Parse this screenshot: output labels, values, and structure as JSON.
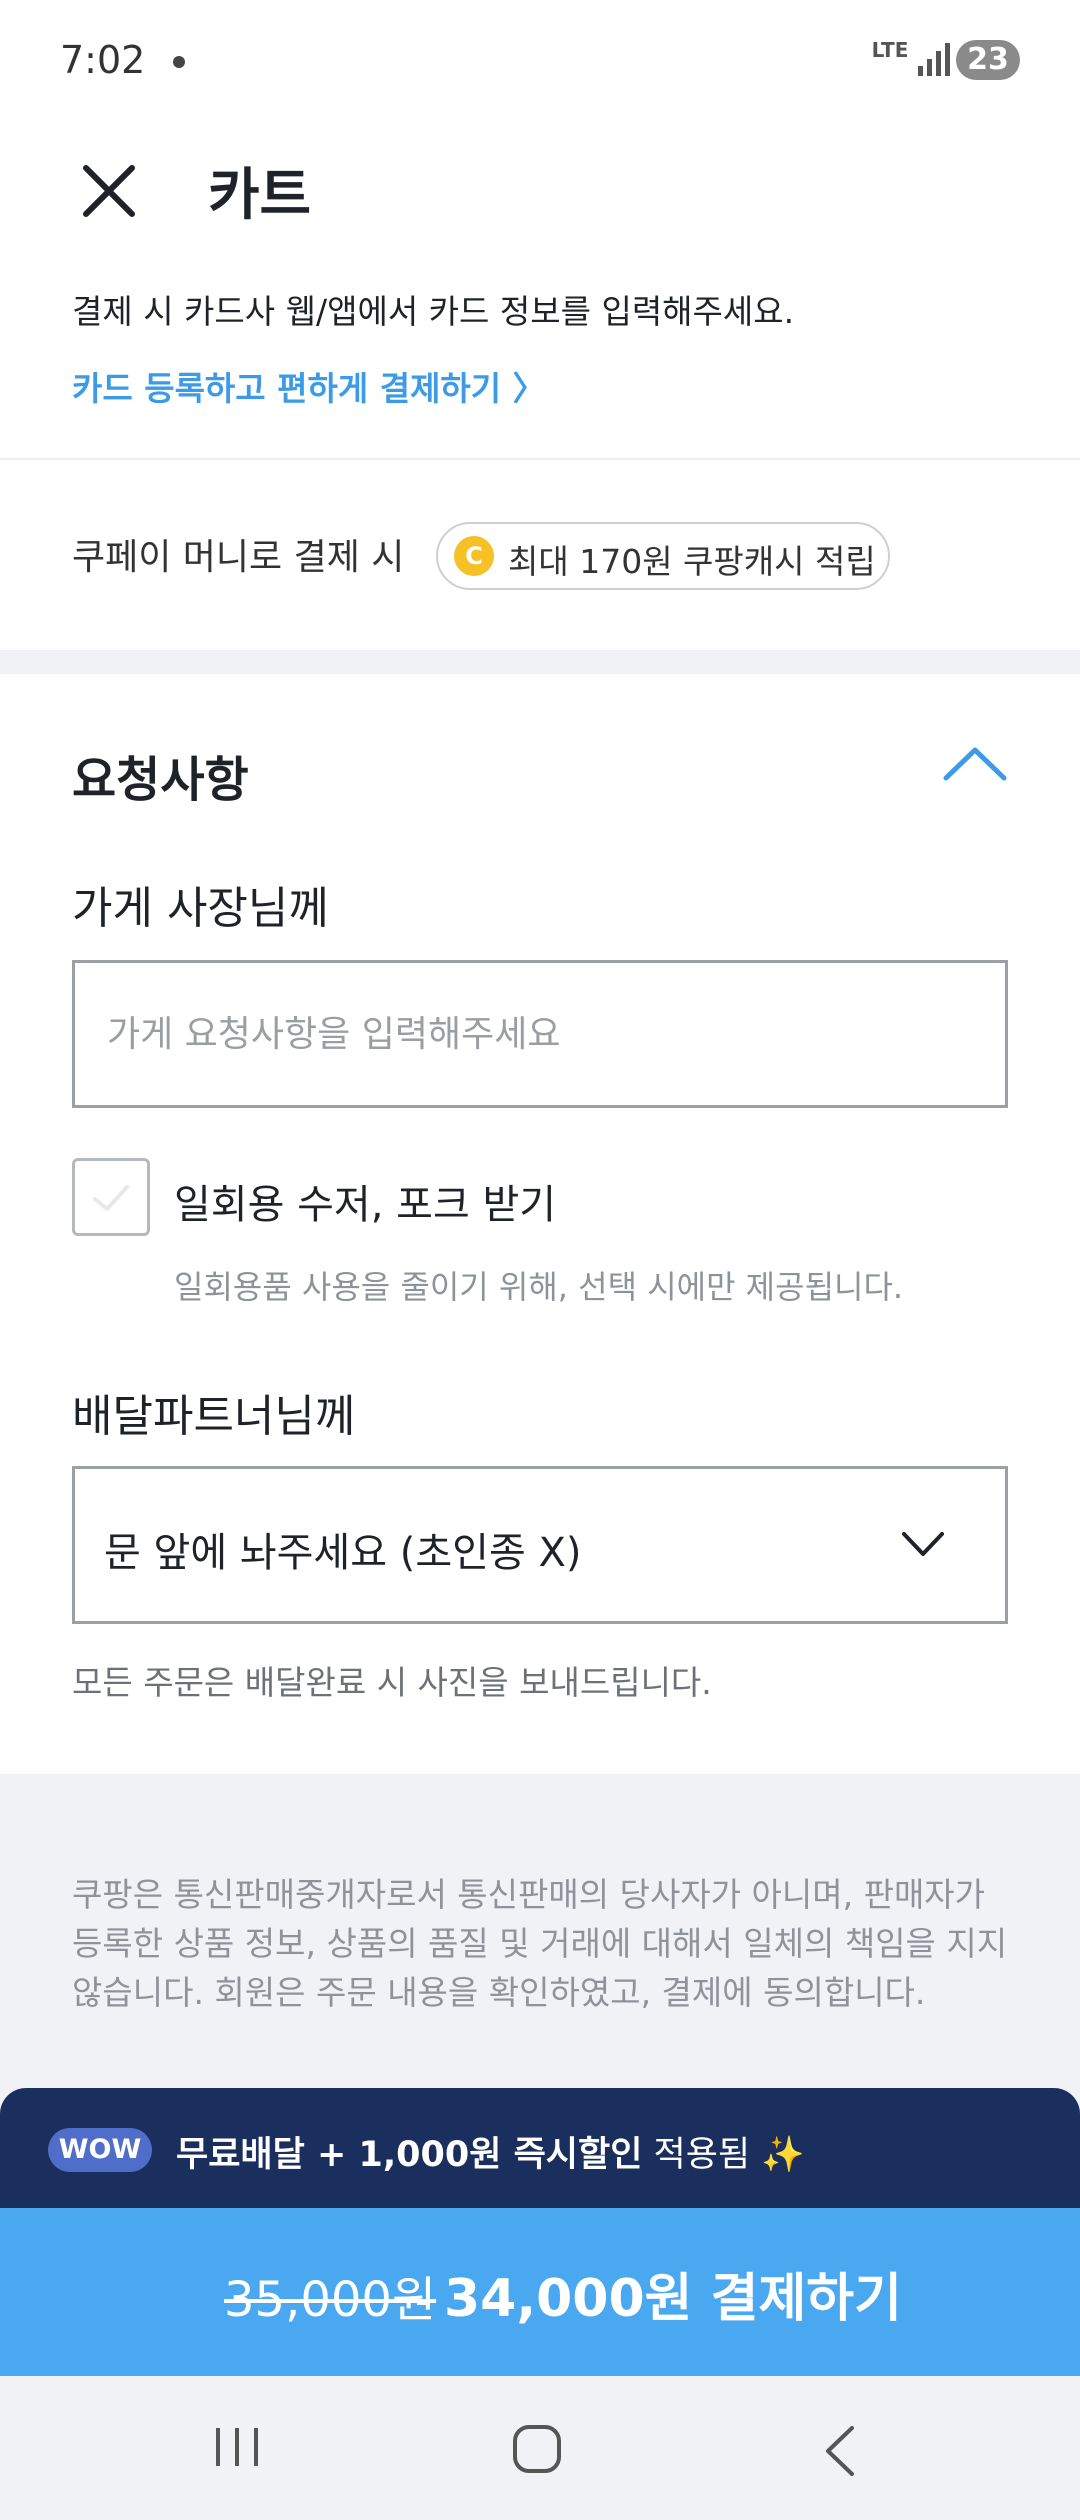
{
  "status_bar": {
    "time": "7:02",
    "network": "LTE",
    "battery": "23"
  },
  "header": {
    "title": "카트"
  },
  "payment": {
    "notice": "결제 시 카드사 웹/앱에서 카드 정보를 입력해주세요.",
    "register_link": "카드 등록하고 편하게 결제하기 〉",
    "coupay_label": "쿠페이 머니로 결제 시",
    "coin_letter": "C",
    "cash_reward": "최대 170원 쿠팡캐시 적립"
  },
  "requests": {
    "section_title": "요청사항",
    "store_label": "가게 사장님께",
    "store_placeholder": "가게 요청사항을 입력해주세요",
    "store_value": "",
    "utensils_label": "일회용 수저, 포크 받기",
    "utensils_checked": false,
    "utensils_hint": "일회용품 사용을 줄이기 위해, 선택 시에만 제공됩니다.",
    "rider_label": "배달파트너님께",
    "rider_selected": "문 앞에 놔주세요 (초인종 X)",
    "photo_note": "모든 주문은 배달완료 시 사진을 보내드립니다."
  },
  "disclaimer": "쿠팡은 통신판매중개자로서 통신판매의 당사자가 아니며, 판매자가 등록한 상품 정보, 상품의 품질 및 거래에 대해서 일체의 책임을 지지 않습니다. 회원은 주문 내용을 확인하였고, 결제에 동의합니다.",
  "wow": {
    "badge": "WOW",
    "benefit": "무료배달 + 1,000원 즉시할인",
    "applied": " 적용됨 ✨"
  },
  "checkout": {
    "original_price": "35,000원",
    "pay_label": "34,000원 결제하기"
  },
  "colors": {
    "accent": "#3b9be8",
    "pay_button": "#4aa8f1",
    "wow_bar": "#1b2f5e",
    "wow_badge": "#4f6ec9",
    "coin": "#f5c127"
  }
}
